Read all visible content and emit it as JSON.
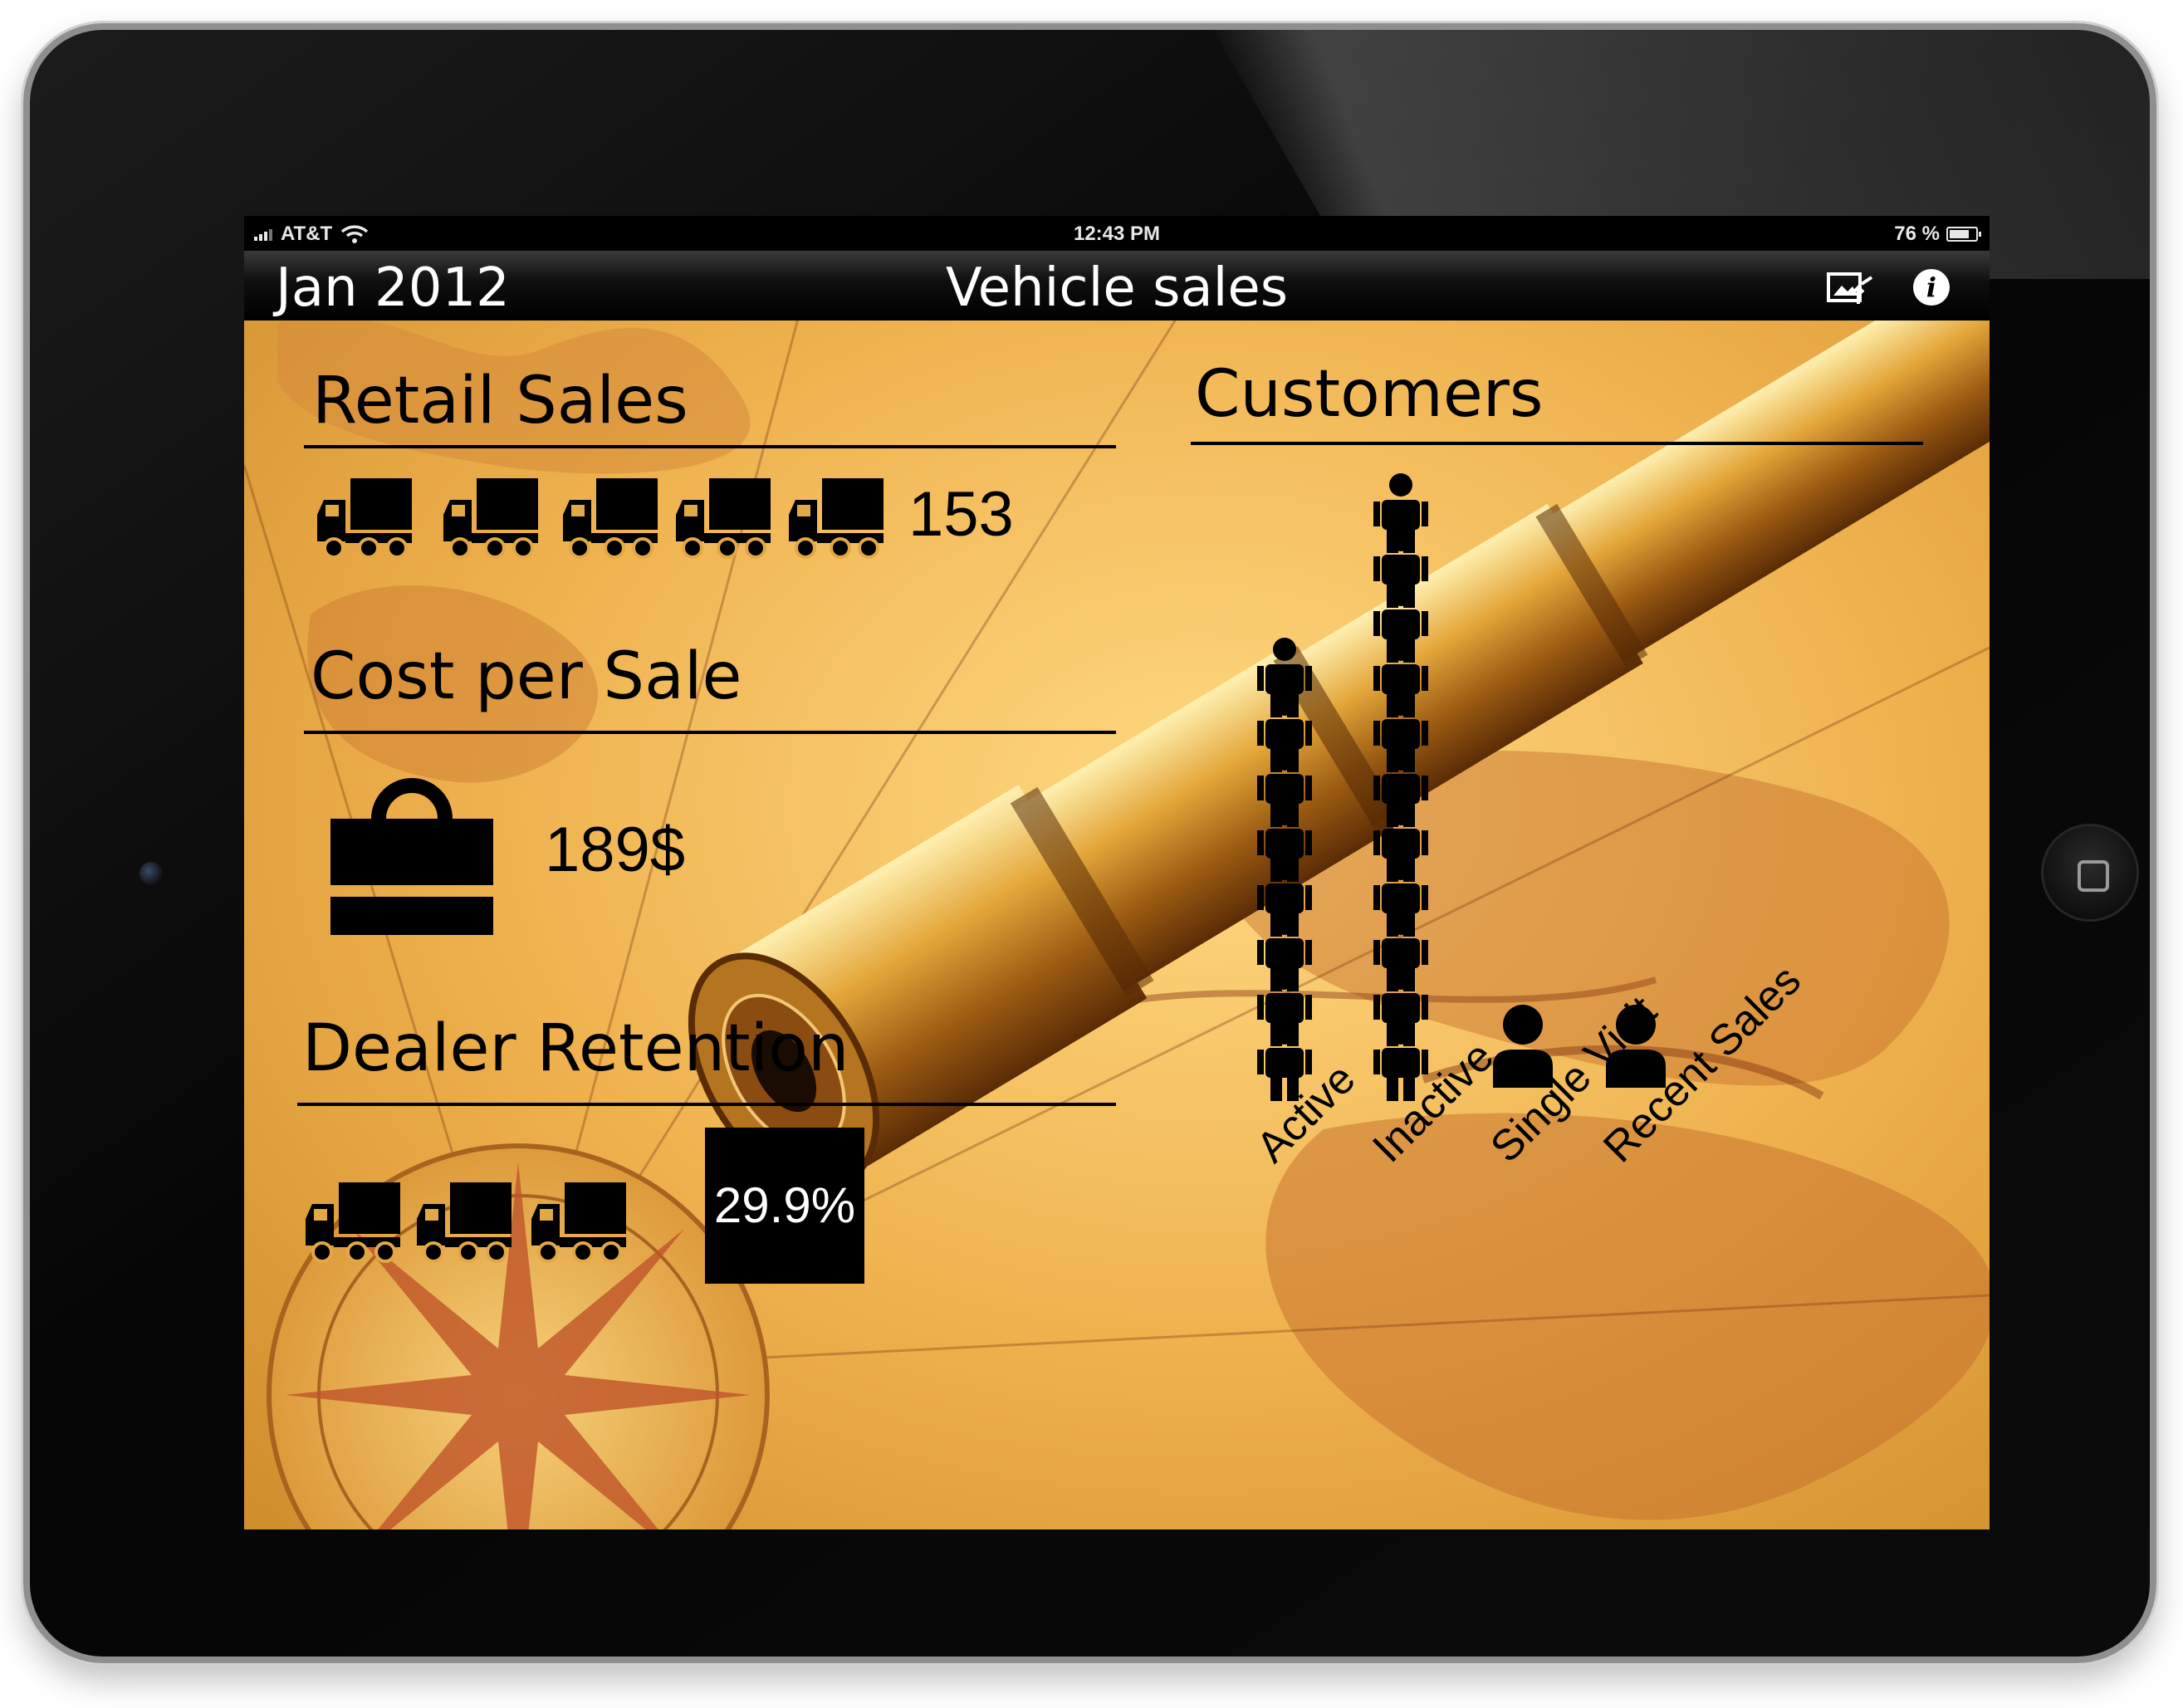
{
  "status_bar": {
    "carrier": "AT&T",
    "time": "12:43 PM",
    "battery_percent": "76 %",
    "battery_level": 0.76
  },
  "nav": {
    "date": "Jan 2012",
    "title": "Vehicle sales",
    "share_icon": "share-export-icon",
    "info_icon": "info-icon",
    "info_glyph": "i"
  },
  "retail_sales": {
    "title": "Retail Sales",
    "value": "153",
    "icon": "truck-icon",
    "icon_count": 5
  },
  "cost_per_sale": {
    "title": "Cost per Sale",
    "value": "189$",
    "icon": "shopping-bag-icon"
  },
  "dealer_retention": {
    "title": "Dealer Retention",
    "value": "29.9%",
    "icon": "truck-icon",
    "icon_count": 3
  },
  "customers": {
    "title": "Customers",
    "icon": "person-icon",
    "chart_data": {
      "type": "bar",
      "categories": [
        "Active",
        "Inactive",
        "Single Visit",
        "Recent Sales"
      ],
      "values": [
        8,
        11,
        1,
        1
      ],
      "title": "Customers"
    }
  },
  "colors": {
    "ink": "#000000",
    "background": "#e2a845",
    "bar": "#000000"
  }
}
